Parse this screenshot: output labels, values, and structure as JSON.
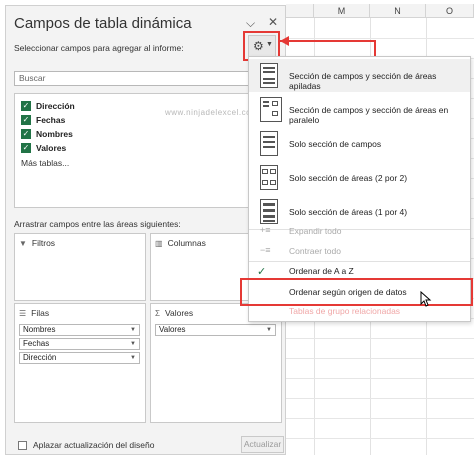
{
  "sheet": {
    "columns": [
      "M",
      "N",
      "O"
    ]
  },
  "panel": {
    "title": "Campos de tabla dinámica",
    "choose_fields_label": "Seleccionar campos para agregar al informe:",
    "search_placeholder": "Buscar",
    "fields": [
      {
        "label": "Dirección",
        "checked": true
      },
      {
        "label": "Fechas",
        "checked": true
      },
      {
        "label": "Nombres",
        "checked": true
      },
      {
        "label": "Valores",
        "checked": true
      }
    ],
    "more_tables": "Más tablas...",
    "watermark": "www.ninjadelexcel.com",
    "drag_label": "Arrastrar campos entre las áreas siguientes:",
    "areas": {
      "filters": {
        "label": "Filtros",
        "icon": "filter-icon"
      },
      "columns": {
        "label": "Columnas",
        "icon": "columns-icon"
      },
      "rows": {
        "label": "Filas",
        "icon": "rows-icon",
        "items": [
          "Nombres",
          "Fechas",
          "Dirección"
        ]
      },
      "values": {
        "label": "Valores",
        "icon": "sigma-icon",
        "items": [
          "Valores"
        ]
      }
    },
    "defer_label": "Aplazar actualización del diseño",
    "update_label": "Actualizar"
  },
  "menu": {
    "layouts": [
      {
        "label": "Sección de campos y sección de áreas apiladas",
        "icon": "layout-stacked-icon"
      },
      {
        "label": "Sección de campos y sección de áreas en paralelo",
        "icon": "layout-side-by-side-icon"
      },
      {
        "label": "Solo sección de campos",
        "icon": "layout-fields-only-icon"
      },
      {
        "label": "Solo sección de áreas (2 por 2)",
        "icon": "layout-areas-2x2-icon"
      },
      {
        "label": "Solo sección de áreas (1 por 4)",
        "icon": "layout-areas-1x4-icon"
      }
    ],
    "expand_all": "Expandir todo",
    "collapse_all": "Contraer todo",
    "sort_az": "Ordenar de A a Z",
    "sort_source": "Ordenar según origen de datos",
    "related_tables": "Tablas de grupo relacionadas"
  },
  "colors": {
    "accent_green": "#217346",
    "highlight_red": "#e53935"
  }
}
